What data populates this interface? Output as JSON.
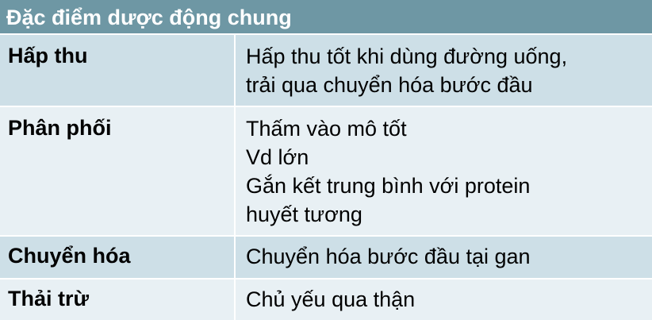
{
  "table": {
    "title": "Đặc điểm dược động chung",
    "rows": [
      {
        "label": "Hấp thu",
        "lines": [
          "Hấp thu tốt khi dùng đường uống,",
          "trải qua chuyển hóa bước đầu"
        ]
      },
      {
        "label": "Phân phối",
        "lines": [
          "Thấm vào mô tốt",
          "Vd lớn",
          "Gắn kết trung bình với protein",
          "huyết tương"
        ]
      },
      {
        "label": "Chuyển hóa",
        "lines": [
          "Chuyển hóa bước đầu tại gan"
        ]
      },
      {
        "label": "Thải trừ",
        "lines": [
          "Chủ yếu qua thận"
        ]
      }
    ]
  }
}
